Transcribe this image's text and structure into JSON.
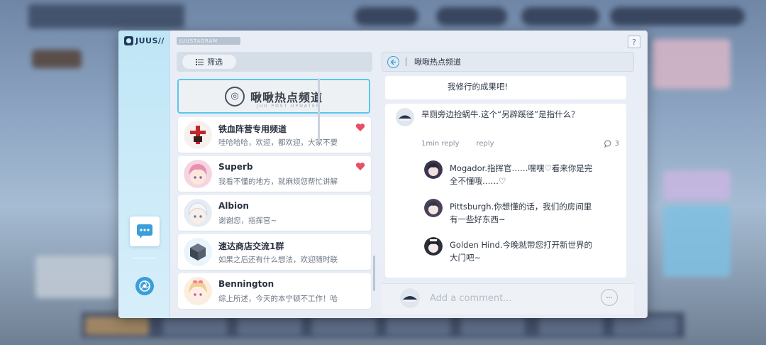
{
  "app": {
    "logo_text": "JUUS//",
    "strip_label": "JUUSTAGRAM",
    "help_label": "?"
  },
  "filter": {
    "label": "筛选"
  },
  "hot_channel": {
    "title": "啾啾热点频道",
    "subtitle": "JUU POST UPDATES"
  },
  "channels": [
    {
      "name": "铁血阵营专用频道",
      "message": "哇哈哈哈，欢迎，都欢迎，大家不要",
      "liked": true,
      "avatar": "ironblood-emblem-icon"
    },
    {
      "name": "Superb",
      "message": "我看不懂的地方，就麻烦您帮忙讲解",
      "liked": true,
      "avatar": "pink-hair-avatar"
    },
    {
      "name": "Albion",
      "message": "谢谢您，指挥官~",
      "liked": false,
      "avatar": "white-hair-avatar"
    },
    {
      "name": "速达商店交流1群",
      "message": "如果之后还有什么想法，欢迎随时联",
      "liked": false,
      "avatar": "package-icon"
    },
    {
      "name": "Bennington",
      "message": "综上所述，今天的本宁顿不工作！哈",
      "liked": false,
      "avatar": "blonde-hair-avatar"
    }
  ],
  "post": {
    "header_title": "啾啾热点频道",
    "previous_tail": "我修行的成果吧!",
    "main_comment": {
      "author": "旱厕旁边捡蜗牛.",
      "text": "这个“另辟蹊径”是指什么？",
      "time": "1min reply",
      "reply_label": "reply",
      "reply_count": "3"
    },
    "replies": [
      {
        "author": "Mogador.",
        "text": "指挥官……嘿嘿♡看来你是完全不懂哦……♡"
      },
      {
        "author": "Pittsburgh.",
        "text": "你想懂的话，我们的房间里有一些好东西~"
      },
      {
        "author": "Golden Hind.",
        "text": "今晚就带您打开新世界的大门吧~"
      }
    ],
    "comment_placeholder": "Add a comment..."
  },
  "colors": {
    "accent": "#3a9fd9",
    "heart": "#ea4d66",
    "highlight_border": "#5cc6ea"
  }
}
